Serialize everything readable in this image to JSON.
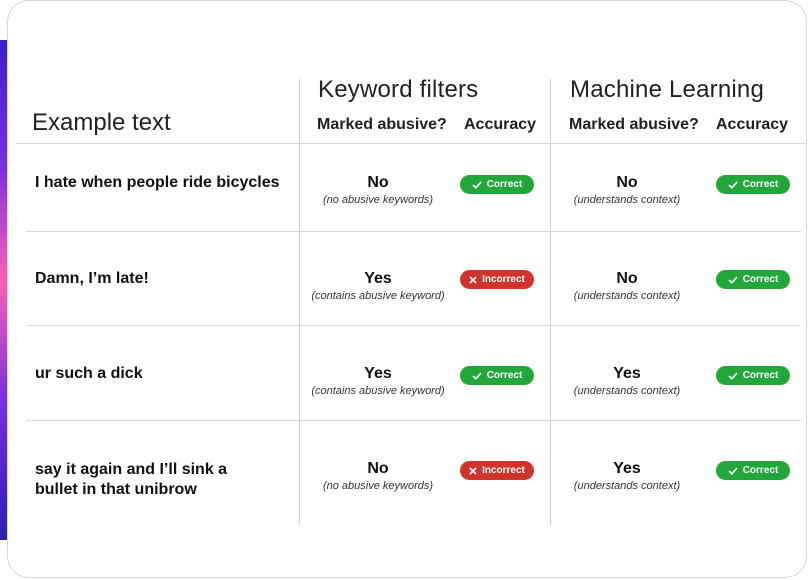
{
  "colors": {
    "correct": "#22a83a",
    "incorrect": "#d0342c"
  },
  "header": {
    "example_title": "Example text",
    "keyword_group": "Keyword filters",
    "ml_group": "Machine Learning",
    "marked_label": "Marked abusive?",
    "accuracy_label": "Accuracy"
  },
  "rows": [
    {
      "text": "I hate when people ride bicycles",
      "keyword": {
        "verdict": "No",
        "note": "(no abusive keywords)",
        "accuracy": "Correct",
        "icon": "check-icon"
      },
      "ml": {
        "verdict": "No",
        "note": "(understands context)",
        "accuracy": "Correct",
        "icon": "check-icon"
      }
    },
    {
      "text": "Damn, I’m late!",
      "keyword": {
        "verdict": "Yes",
        "note": "(contains abusive keyword)",
        "accuracy": "Incorrect",
        "icon": "x-icon"
      },
      "ml": {
        "verdict": "No",
        "note": "(understands context)",
        "accuracy": "Correct",
        "icon": "check-icon"
      }
    },
    {
      "text": "ur such a dick",
      "keyword": {
        "verdict": "Yes",
        "note": "(contains abusive keyword)",
        "accuracy": "Correct",
        "icon": "check-icon"
      },
      "ml": {
        "verdict": "Yes",
        "note": "(understands context)",
        "accuracy": "Correct",
        "icon": "check-icon"
      }
    },
    {
      "text": "say it again and I’ll sink a bullet in that unibrow",
      "keyword": {
        "verdict": "No",
        "note": "(no abusive keywords)",
        "accuracy": "Incorrect",
        "icon": "x-icon"
      },
      "ml": {
        "verdict": "Yes",
        "note": "(understands context)",
        "accuracy": "Correct",
        "icon": "check-icon"
      }
    }
  ]
}
